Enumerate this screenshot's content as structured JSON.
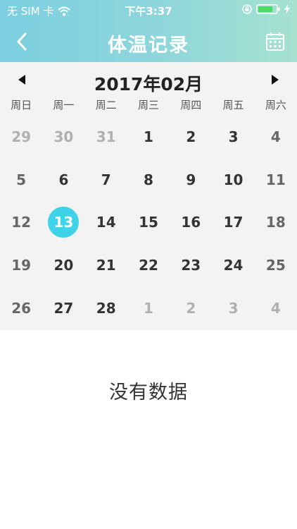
{
  "status_bar": {
    "carrier": "无 SIM 卡",
    "time": "下午3:37",
    "icons": [
      "wifi-icon",
      "orientation-lock-icon",
      "battery-icon",
      "charging-icon"
    ]
  },
  "nav": {
    "title": "体温记录",
    "back_icon": "chevron-left-icon",
    "calendar_icon": "calendar-icon"
  },
  "calendar": {
    "month_label": "2017年02月",
    "prev_icon": "triangle-left-icon",
    "next_icon": "triangle-right-icon",
    "weekdays": [
      "周日",
      "周一",
      "周二",
      "周三",
      "周四",
      "周五",
      "周六"
    ],
    "days": [
      {
        "label": "29",
        "in_month": false
      },
      {
        "label": "30",
        "in_month": false
      },
      {
        "label": "31",
        "in_month": false
      },
      {
        "label": "1",
        "in_month": true
      },
      {
        "label": "2",
        "in_month": true
      },
      {
        "label": "3",
        "in_month": true
      },
      {
        "label": "4",
        "in_month": true
      },
      {
        "label": "5",
        "in_month": true
      },
      {
        "label": "6",
        "in_month": true
      },
      {
        "label": "7",
        "in_month": true
      },
      {
        "label": "8",
        "in_month": true
      },
      {
        "label": "9",
        "in_month": true
      },
      {
        "label": "10",
        "in_month": true
      },
      {
        "label": "11",
        "in_month": true
      },
      {
        "label": "12",
        "in_month": true
      },
      {
        "label": "13",
        "in_month": true,
        "selected": true
      },
      {
        "label": "14",
        "in_month": true
      },
      {
        "label": "15",
        "in_month": true
      },
      {
        "label": "16",
        "in_month": true
      },
      {
        "label": "17",
        "in_month": true
      },
      {
        "label": "18",
        "in_month": true
      },
      {
        "label": "19",
        "in_month": true
      },
      {
        "label": "20",
        "in_month": true
      },
      {
        "label": "21",
        "in_month": true
      },
      {
        "label": "22",
        "in_month": true
      },
      {
        "label": "23",
        "in_month": true
      },
      {
        "label": "24",
        "in_month": true
      },
      {
        "label": "25",
        "in_month": true
      },
      {
        "label": "26",
        "in_month": true
      },
      {
        "label": "27",
        "in_month": true
      },
      {
        "label": "28",
        "in_month": true
      },
      {
        "label": "1",
        "in_month": false
      },
      {
        "label": "2",
        "in_month": false
      },
      {
        "label": "3",
        "in_month": false
      },
      {
        "label": "4",
        "in_month": false
      }
    ]
  },
  "empty_state": {
    "message": "没有数据"
  },
  "colors": {
    "header_start": "#7ccfe0",
    "header_end": "#a6e2cf",
    "selected_day": "#3fd3ea",
    "calendar_bg": "#f3f3f3"
  }
}
